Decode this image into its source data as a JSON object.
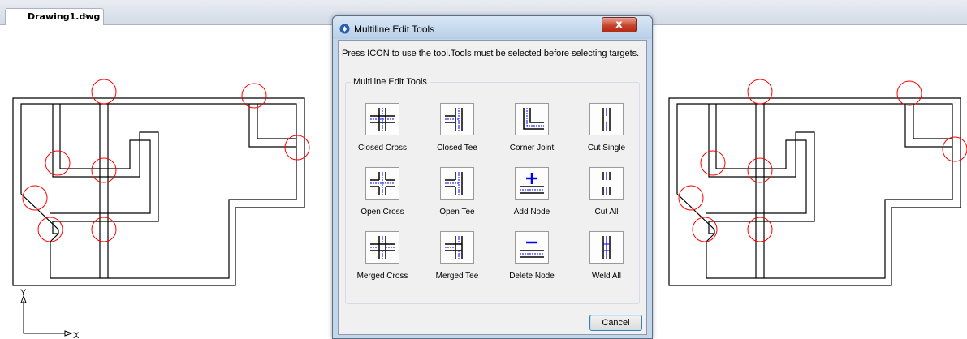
{
  "tab": {
    "title": "Drawing1.dwg",
    "close": "×"
  },
  "axis": {
    "y": "Y",
    "x": "X"
  },
  "dialog": {
    "title": "Multiline Edit Tools",
    "close": "x",
    "instruction": "Press ICON to use the tool.Tools must be selected before selecting targets.",
    "group_title": "Multiline Edit Tools",
    "tools": [
      {
        "label": "Closed Cross",
        "icon": "closed-cross-icon"
      },
      {
        "label": "Closed Tee",
        "icon": "closed-tee-icon"
      },
      {
        "label": "Corner Joint",
        "icon": "corner-joint-icon"
      },
      {
        "label": "Cut Single",
        "icon": "cut-single-icon"
      },
      {
        "label": "Open Cross",
        "icon": "open-cross-icon"
      },
      {
        "label": "Open Tee",
        "icon": "open-tee-icon"
      },
      {
        "label": "Add Node",
        "icon": "add-node-icon"
      },
      {
        "label": "Cut All",
        "icon": "cut-all-icon"
      },
      {
        "label": "Merged Cross",
        "icon": "merged-cross-icon"
      },
      {
        "label": "Merged Tee",
        "icon": "merged-tee-icon"
      },
      {
        "label": "Delete Node",
        "icon": "delete-node-icon"
      },
      {
        "label": "Weld All",
        "icon": "weld-all-icon"
      }
    ],
    "cancel": "Cancel"
  },
  "colors": {
    "accent": "#0000ff",
    "highlight_circle": "#ff0000",
    "titlebar": "#c3d6ea"
  }
}
